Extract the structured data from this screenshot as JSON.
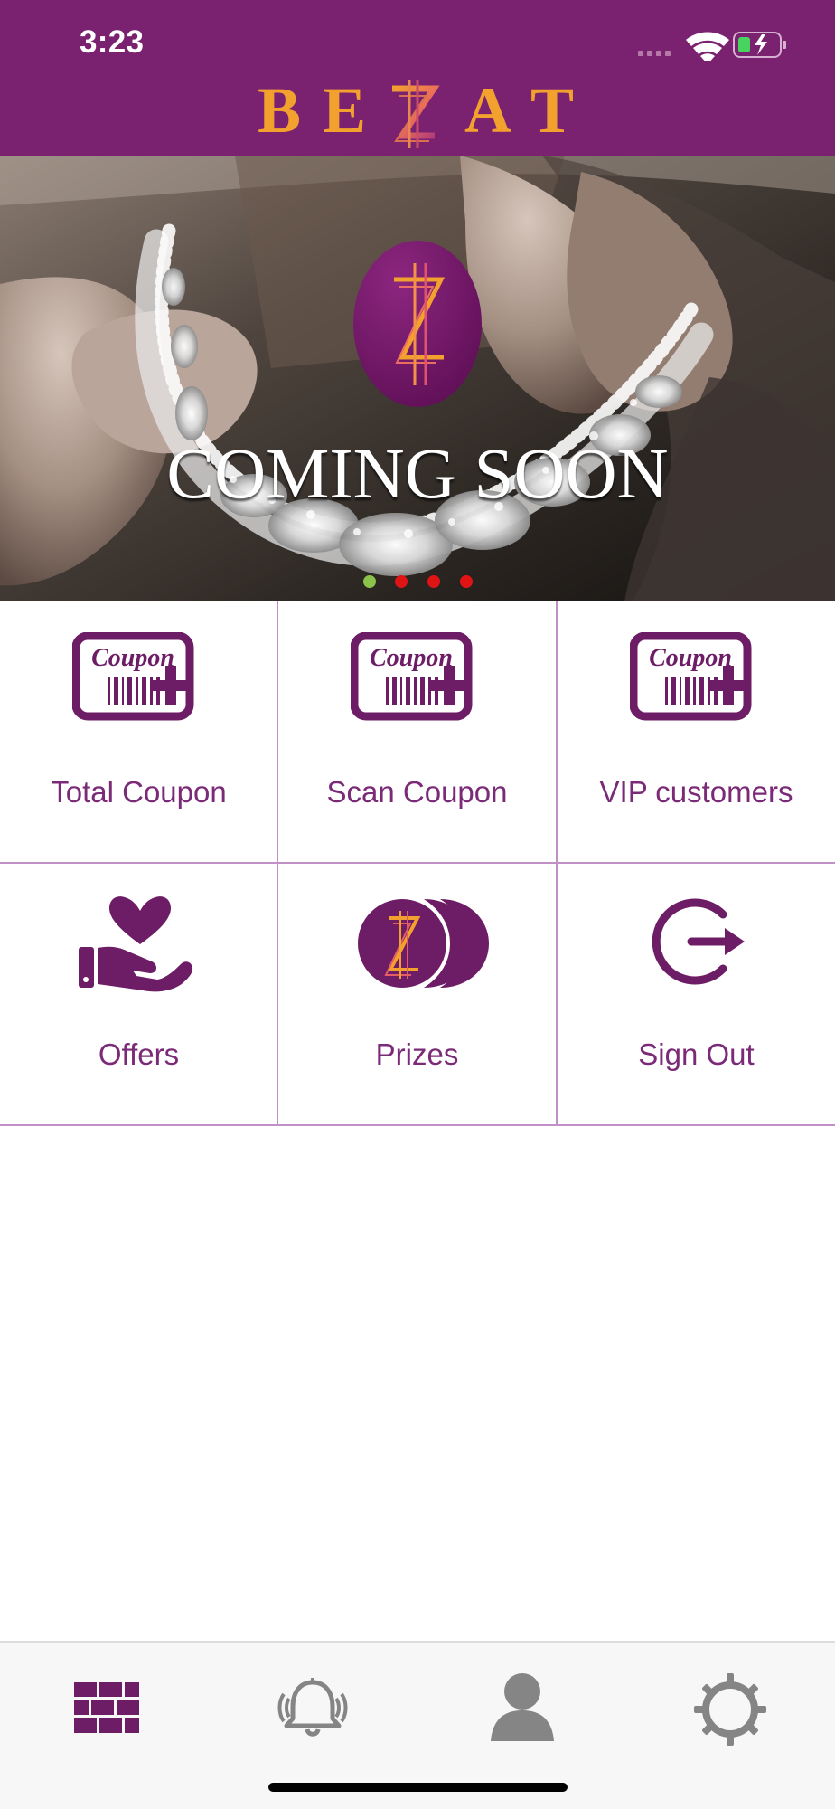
{
  "status_bar": {
    "time": "3:23"
  },
  "header": {
    "brand_letters": [
      "B",
      "E",
      "A",
      "T"
    ]
  },
  "banner": {
    "overlay_text": "COMING SOON",
    "carousel_dots": [
      {
        "state": "active",
        "color": "#8bc34a"
      },
      {
        "state": "inactive",
        "color": "#e01414"
      },
      {
        "state": "inactive",
        "color": "#e01414"
      },
      {
        "state": "inactive",
        "color": "#e01414"
      }
    ]
  },
  "menu": {
    "tiles": [
      {
        "id": "total-coupon",
        "label": "Total Coupon",
        "icon": "coupon-icon",
        "icon_text": "Coupon"
      },
      {
        "id": "scan-coupon",
        "label": "Scan Coupon",
        "icon": "coupon-icon",
        "icon_text": "Coupon"
      },
      {
        "id": "vip-customers",
        "label": "VIP customers",
        "icon": "coupon-icon",
        "icon_text": "Coupon"
      },
      {
        "id": "offers",
        "label": "Offers",
        "icon": "heart-hand-icon"
      },
      {
        "id": "prizes",
        "label": "Prizes",
        "icon": "coins-icon"
      },
      {
        "id": "sign-out",
        "label": "Sign Out",
        "icon": "sign-out-icon"
      }
    ]
  },
  "bottom_nav": {
    "items": [
      {
        "id": "dashboard",
        "icon": "grid-icon",
        "active": true
      },
      {
        "id": "notifications",
        "icon": "bell-icon",
        "active": false
      },
      {
        "id": "profile",
        "icon": "user-icon",
        "active": false
      },
      {
        "id": "settings",
        "icon": "gear-icon",
        "active": false
      }
    ]
  },
  "colors": {
    "brand_purple": "#7a216f",
    "accent_orange": "#f3a12e",
    "tile_text": "#7b2a78",
    "divider": "#c190c6",
    "nav_inactive": "#858585"
  }
}
